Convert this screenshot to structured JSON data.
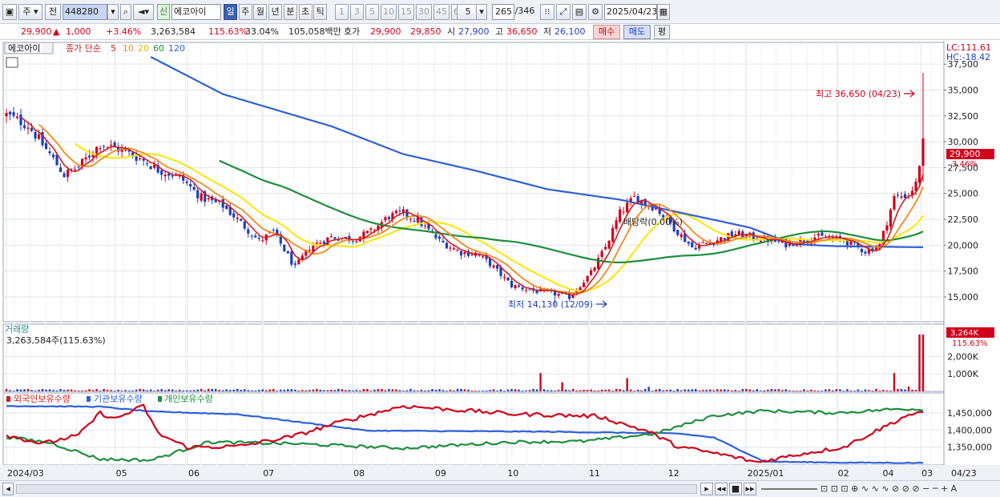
{
  "toolbar": {
    "period_left": "주",
    "prev_label": "전",
    "code": "448280",
    "new_badge": "신",
    "stock_name": "에코아이",
    "tf_buttons": [
      "일",
      "주",
      "월",
      "년",
      "분",
      "초",
      "틱"
    ],
    "active_tf": "일",
    "interval_buttons": [
      "1",
      "3",
      "5",
      "10",
      "15",
      "30",
      "45",
      "60"
    ],
    "interval_select": "5",
    "count": "265",
    "count_total": "/346",
    "date": "2025/04/23"
  },
  "quote": {
    "price": "29,900",
    "change": "1,000",
    "change_pct": "+3.46%",
    "volume": "3,263,584",
    "volume_ratio": "115.63%",
    "turnover": "33.04%",
    "amount": "105,058백만",
    "bid_label": "호가",
    "ask_price": "29,900",
    "bid_price": "29,850",
    "open_label": "시",
    "open": "27,900",
    "high_label": "고",
    "high": "36,650",
    "low_label": "저",
    "low": "26,100",
    "buy_button": "매수",
    "sell_button": "매도",
    "avg_button": "평"
  },
  "price_panel": {
    "name_tag": "에코아이",
    "ma_title": "종가 단순",
    "ma_periods": [
      "5",
      "10",
      "20",
      "60",
      "120"
    ],
    "lc": "LC:111.61",
    "hc": "HC:-18.42",
    "last_price": "29,900",
    "last_pct": "3.46%",
    "high_annotation": "최고 36,650 (04/23)",
    "low_annotation": "최저 14,130 (12/09)",
    "dividend_annotation": "배당락(0.00%)"
  },
  "volume_panel": {
    "title": "거래량",
    "value_text": "3,263,584주(115.63%)",
    "last_tag": "3,264K",
    "last_pct": "115.63%"
  },
  "holder_panel": {
    "legend_foreign": "외국인보유수량",
    "legend_inst": "기관보유수량",
    "legend_indiv": "개인보유수량"
  },
  "x_axis_labels": [
    "2024/03",
    "05",
    "06",
    "07",
    "08",
    "09",
    "10",
    "11",
    "12",
    "2025/01",
    "02",
    "03",
    "04"
  ],
  "x_axis_last": "04/23",
  "chart_data": {
    "type": "candlestick",
    "price_axis": {
      "ticks": [
        15000,
        17500,
        20000,
        22500,
        25000,
        27500,
        30000,
        32500,
        35000,
        37500
      ],
      "range": [
        12600,
        39600
      ]
    },
    "volume_axis": {
      "ticks": [
        "1,000K",
        "2,000K"
      ],
      "range_k": [
        0,
        3400
      ]
    },
    "holder_axis": {
      "ticks": [
        "1,350,000",
        "1,400,000",
        "1,450,000"
      ],
      "range": [
        1298000,
        1508000
      ]
    },
    "colors": {
      "up": "#d0021b",
      "down": "#1c3fbf",
      "ma5": "#cc1f1f",
      "ma10": "#f08a1c",
      "ma20": "#ffe400",
      "ma60": "#1f8f3f",
      "ma120": "#2f5fd8"
    },
    "price_keyframes": [
      [
        0,
        32600
      ],
      [
        6,
        31600
      ],
      [
        12,
        28800
      ],
      [
        16,
        26800
      ],
      [
        20,
        27600
      ],
      [
        26,
        29800
      ],
      [
        32,
        29200
      ],
      [
        38,
        28200
      ],
      [
        42,
        27300
      ],
      [
        48,
        26600
      ],
      [
        54,
        24600
      ],
      [
        60,
        23800
      ],
      [
        64,
        22500
      ],
      [
        70,
        20400
      ],
      [
        74,
        21300
      ],
      [
        80,
        17800
      ],
      [
        84,
        19800
      ],
      [
        90,
        20800
      ],
      [
        96,
        20600
      ],
      [
        101,
        21300
      ],
      [
        106,
        22800
      ],
      [
        110,
        23100
      ],
      [
        114,
        22400
      ],
      [
        120,
        20400
      ],
      [
        126,
        19300
      ],
      [
        130,
        19200
      ],
      [
        134,
        18200
      ],
      [
        140,
        16100
      ],
      [
        146,
        15600
      ],
      [
        152,
        15300
      ],
      [
        156,
        15000
      ],
      [
        162,
        17300
      ],
      [
        166,
        19800
      ],
      [
        170,
        23100
      ],
      [
        174,
        24600
      ],
      [
        180,
        23600
      ],
      [
        186,
        21300
      ],
      [
        190,
        19800
      ],
      [
        196,
        20400
      ],
      [
        202,
        21100
      ],
      [
        210,
        20600
      ],
      [
        216,
        20100
      ],
      [
        224,
        20800
      ],
      [
        232,
        20500
      ],
      [
        238,
        19400
      ],
      [
        242,
        20000
      ],
      [
        246,
        24600
      ],
      [
        250,
        24900
      ],
      [
        252,
        25900
      ],
      [
        254,
        29900
      ]
    ],
    "ma120_points": [
      [
        40,
        38200
      ],
      [
        60,
        34600
      ],
      [
        90,
        31500
      ],
      [
        110,
        28800
      ],
      [
        130,
        27200
      ],
      [
        150,
        25400
      ],
      [
        170,
        24400
      ],
      [
        190,
        22900
      ],
      [
        206,
        21700
      ],
      [
        218,
        20100
      ],
      [
        230,
        19900
      ],
      [
        254,
        19800
      ]
    ],
    "volume_spikes_k": [
      [
        148,
        1050
      ],
      [
        154,
        520
      ],
      [
        172,
        760
      ],
      [
        178,
        260
      ],
      [
        246,
        1050
      ],
      [
        250,
        280
      ],
      [
        253,
        3264
      ],
      [
        254,
        3264
      ]
    ],
    "holder_keyframes": {
      "inst": [
        [
          0,
          1470000
        ],
        [
          26,
          1468000
        ],
        [
          40,
          1454000
        ],
        [
          64,
          1446000
        ],
        [
          100,
          1398000
        ],
        [
          150,
          1395000
        ],
        [
          186,
          1390000
        ],
        [
          196,
          1378000
        ],
        [
          210,
          1308000
        ],
        [
          230,
          1305000
        ],
        [
          254,
          1304000
        ]
      ],
      "foreign": [
        [
          0,
          1385000
        ],
        [
          10,
          1360000
        ],
        [
          20,
          1385000
        ],
        [
          26,
          1450000
        ],
        [
          30,
          1432000
        ],
        [
          38,
          1470000
        ],
        [
          42,
          1390000
        ],
        [
          50,
          1350000
        ],
        [
          64,
          1352000
        ],
        [
          80,
          1383000
        ],
        [
          92,
          1422000
        ],
        [
          110,
          1470000
        ],
        [
          140,
          1447000
        ],
        [
          164,
          1440000
        ],
        [
          178,
          1395000
        ],
        [
          186,
          1352000
        ],
        [
          200,
          1325000
        ],
        [
          208,
          1306000
        ],
        [
          220,
          1330000
        ],
        [
          232,
          1350000
        ],
        [
          250,
          1445000
        ],
        [
          254,
          1448000
        ]
      ],
      "indiv": [
        [
          0,
          1380000
        ],
        [
          12,
          1363000
        ],
        [
          26,
          1315000
        ],
        [
          40,
          1312000
        ],
        [
          56,
          1365000
        ],
        [
          80,
          1360000
        ],
        [
          110,
          1347000
        ],
        [
          140,
          1365000
        ],
        [
          160,
          1367000
        ],
        [
          180,
          1390000
        ],
        [
          196,
          1442000
        ],
        [
          210,
          1456000
        ],
        [
          230,
          1450000
        ],
        [
          248,
          1462000
        ],
        [
          254,
          1460000
        ]
      ]
    }
  }
}
